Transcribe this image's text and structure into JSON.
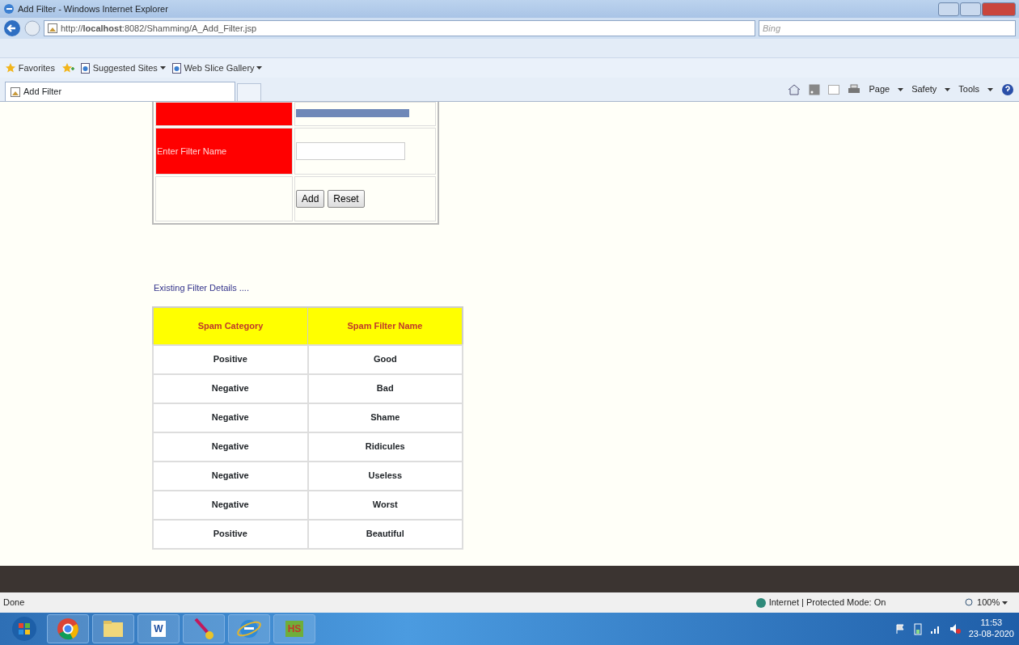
{
  "window": {
    "title": "Add Filter - Windows Internet Explorer"
  },
  "address_bar": {
    "url": "http://**localhost**:8082/Shamming/A_Add_Filter.jsp"
  },
  "search": {
    "placeholder": "Bing"
  },
  "favorites_bar": {
    "favorites": "Favorites",
    "links": [
      "Suggested Sites",
      "Web Slice Gallery"
    ]
  },
  "tabs": [
    {
      "label": "Add Filter",
      "selected": true
    }
  ],
  "command_bar": [
    "Page",
    "Safety",
    "Tools"
  ],
  "form": {
    "field_label": "Enter Filter Name",
    "buttons": [
      "Add",
      "Reset"
    ]
  },
  "section_title": "Existing Filter Details ....",
  "table": {
    "columns": [
      "Spam Category",
      "Spam Filter Name"
    ],
    "rows": [
      [
        "Positive",
        "Good"
      ],
      [
        "Negative",
        "Bad"
      ],
      [
        "Negative",
        "Shame"
      ],
      [
        "Negative",
        "Ridicules"
      ],
      [
        "Negative",
        "Useless"
      ],
      [
        "Negative",
        "Worst"
      ],
      [
        "Positive",
        "Beautiful"
      ]
    ]
  },
  "status_bar": {
    "text": "Done",
    "zone": "Internet | Protected Mode: On",
    "zoom": "100%"
  },
  "taskbar": {
    "apps": [
      {
        "kind": "start"
      },
      {
        "kind": "chrome"
      },
      {
        "kind": "folder"
      },
      {
        "kind": "word",
        "label": "W"
      },
      {
        "kind": "tool"
      },
      {
        "kind": "ie"
      },
      {
        "kind": "hs",
        "label": "HS"
      }
    ],
    "time": "11:53",
    "date": "23-08-2020"
  }
}
